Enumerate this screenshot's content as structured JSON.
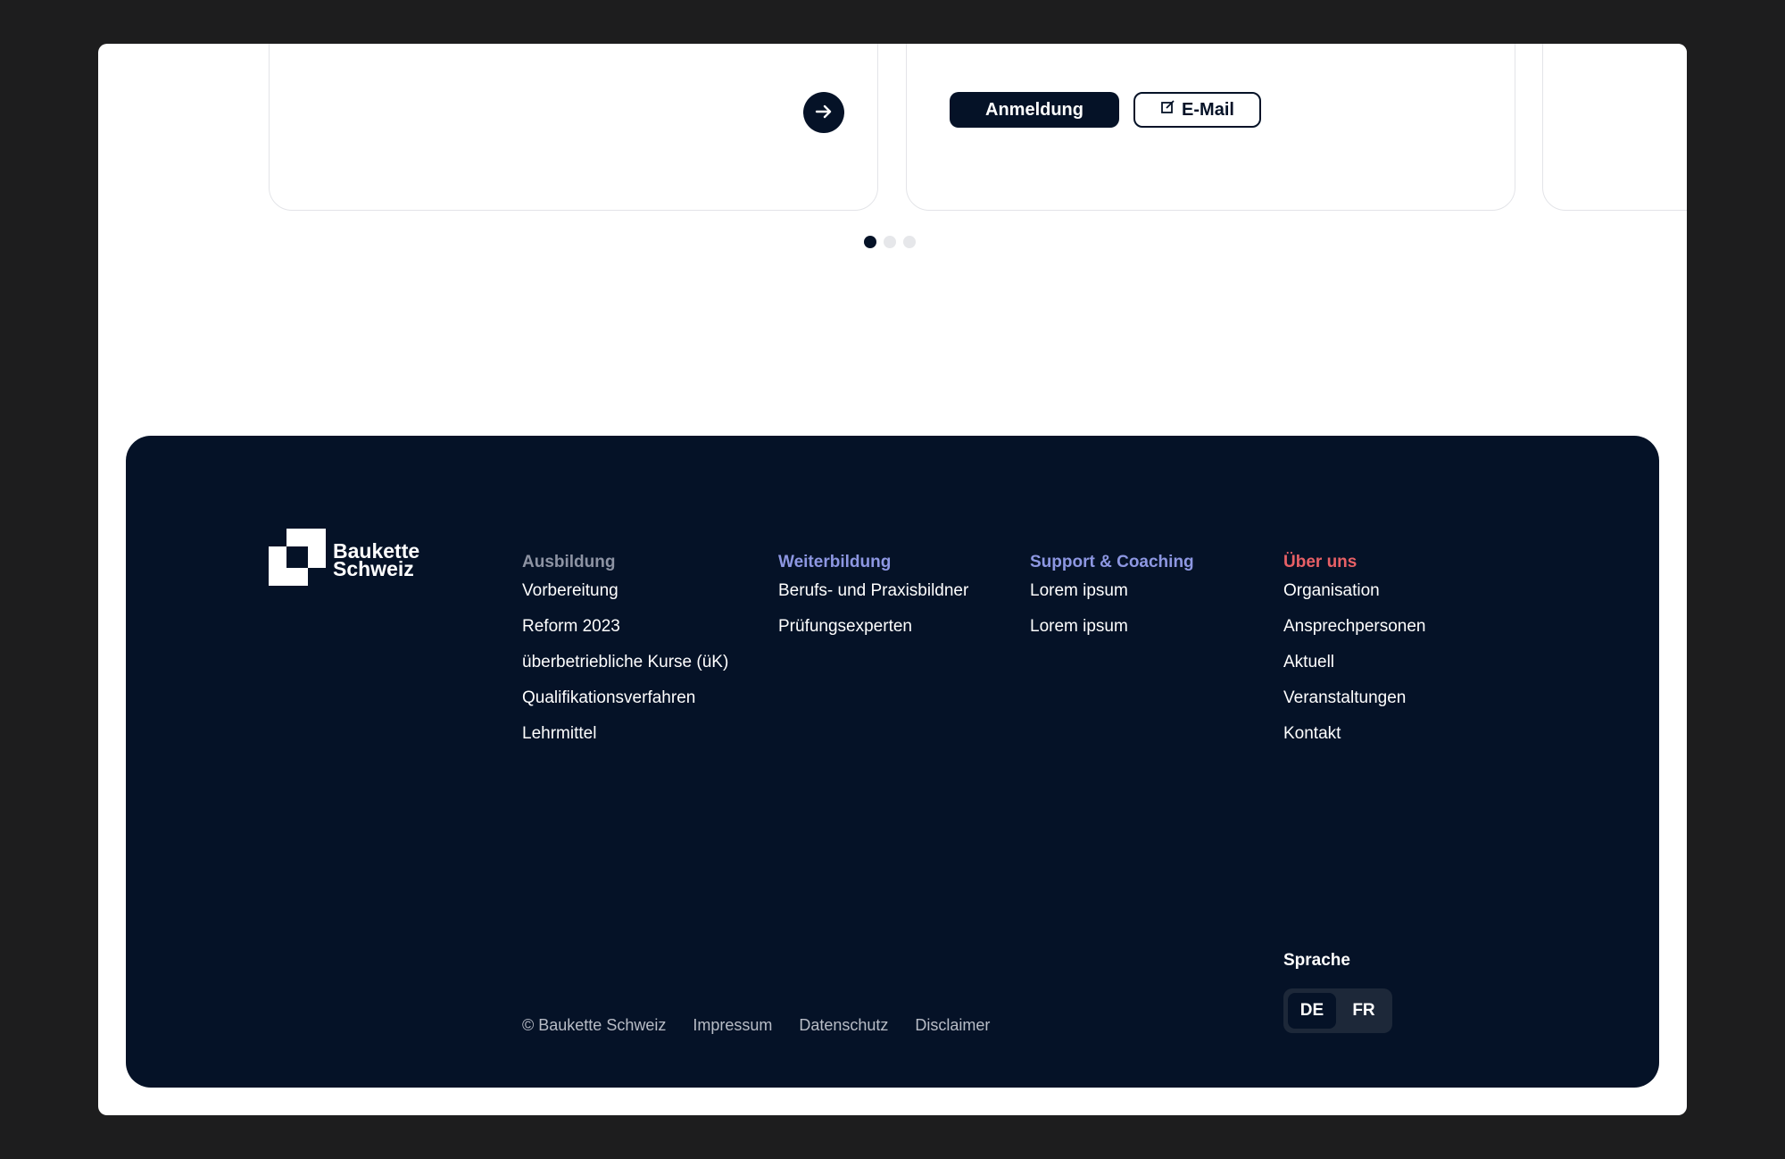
{
  "cards": {
    "register_label": "Anmeldung",
    "email_label": "E-Mail",
    "arrow_icon": "arrow-right-icon",
    "edit_icon": "edit-icon"
  },
  "carousel": {
    "page_count": 3,
    "active_index": 0
  },
  "footer": {
    "logo": {
      "line1": "Baukette",
      "line2": "Schweiz"
    },
    "columns": [
      {
        "heading": "Ausbildung",
        "color": "#8d93a3",
        "links": [
          "Vorbereitung",
          "Reform 2023",
          "überbetriebliche Kurse (üK)",
          "Qualifikationsverfahren",
          "Lehrmittel"
        ]
      },
      {
        "heading": "Weiterbildung",
        "color": "#8d97e2",
        "links": [
          "Berufs- und Praxisbildner",
          "Prüfungsexperten"
        ]
      },
      {
        "heading": "Support & Coaching",
        "color": "#8d97e2",
        "links": [
          "Lorem ipsum",
          "Lorem ipsum"
        ]
      },
      {
        "heading": "Über uns",
        "color": "#e86066",
        "links": [
          "Organisation",
          "Ansprechpersonen",
          "Aktuell",
          "Veranstaltungen",
          "Kontakt"
        ]
      }
    ],
    "legal": {
      "copyright": "© Baukette Schweiz",
      "impressum": "Impressum",
      "datenschutz": "Datenschutz",
      "disclaimer": "Disclaimer"
    },
    "language": {
      "label": "Sprache",
      "options": [
        "DE",
        "FR"
      ],
      "selected": "DE"
    }
  },
  "colors": {
    "navy": "#051227",
    "white": "#ffffff"
  }
}
